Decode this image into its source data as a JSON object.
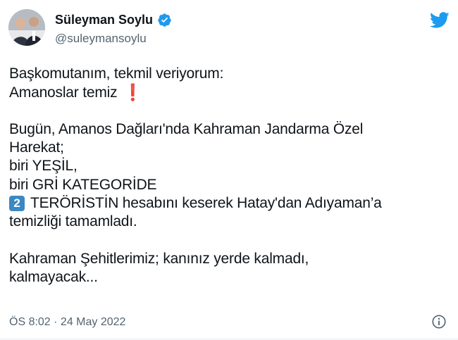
{
  "author": {
    "name": "Süleyman Soylu",
    "handle": "@suleymansoylu",
    "avatar_icon": "profile-photo",
    "verified_icon": "verified-badge-icon"
  },
  "brand_icon": "twitter-bird-icon",
  "colors": {
    "twitter_blue": "#1d9bf0",
    "text": "#0f1419",
    "secondary_text": "#536471",
    "exclamation_red": "#e0202a",
    "keycap_blue": "#3b88c3"
  },
  "tweet": {
    "lines": {
      "l1": "Başkomutanım, tekmil veriyorum:",
      "l2": "Amanoslar temiz",
      "l2_emoji": "❗",
      "l3": "Bugün, Amanos Dağları'nda Kahraman Jandarma Özel",
      "l4": "Harekat;",
      "l5": "biri YEŞİL,",
      "l6": "biri GRİ KATEGORİDE",
      "l7_keycap": "2",
      "l7": "TERÖRİSTİN hesabını keserek Hatay'dan Adıyaman’a",
      "l8": "temizliği tamamladı.",
      "l9": "Kahraman Şehitlerimiz; kanınız yerde kalmadı,",
      "l10": "kalmayacak..."
    },
    "timestamp": "ÖS 8:02 · 24 May 2022",
    "info_icon": "info-icon"
  }
}
